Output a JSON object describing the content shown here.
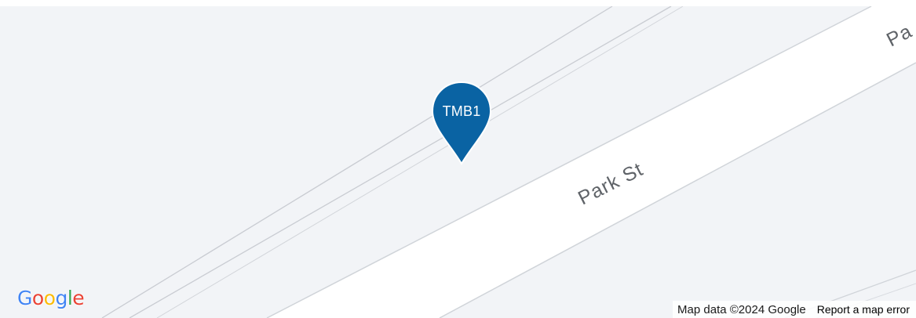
{
  "map": {
    "road_labels": [
      "Park St",
      "Pa"
    ],
    "road_color": "#ffffff",
    "background_color": "#f2f4f7",
    "line_color": "#c7cbd1"
  },
  "marker": {
    "label": "TMB1",
    "color": "#0a63a3",
    "icon": "map-pin-icon"
  },
  "logo": {
    "letters": [
      "G",
      "o",
      "o",
      "g",
      "l",
      "e"
    ],
    "colors": [
      "#4285f4",
      "#ea4335",
      "#fbbc05",
      "#4285f4",
      "#34a853",
      "#ea4335"
    ]
  },
  "footer": {
    "map_data": "Map data ©2024 Google",
    "report_link": "Report a map error"
  }
}
